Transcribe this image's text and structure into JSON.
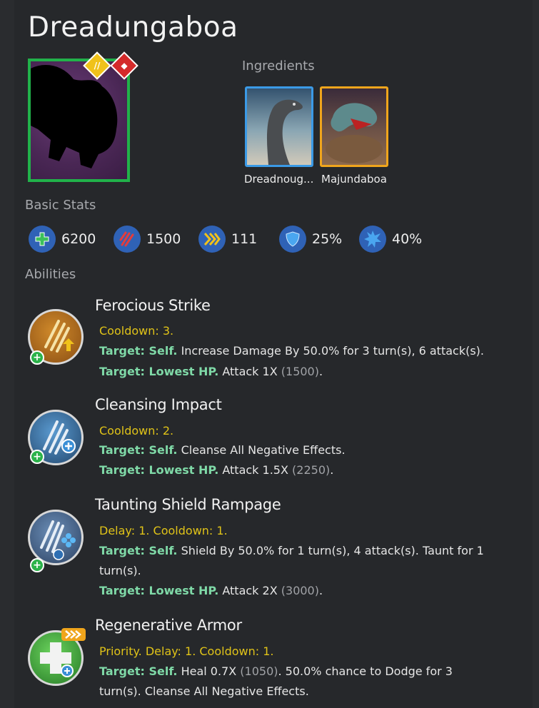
{
  "title": "Dreadungaboa",
  "ingredients": {
    "label": "Ingredients",
    "items": [
      {
        "name": "Dreadnoug..."
      },
      {
        "name": "Majundaboa"
      }
    ]
  },
  "basic_stats": {
    "label": "Basic Stats",
    "items": [
      {
        "icon": "health-icon",
        "value": "6200"
      },
      {
        "icon": "damage-icon",
        "value": "1500"
      },
      {
        "icon": "speed-icon",
        "value": "111"
      },
      {
        "icon": "armor-icon",
        "value": "25%"
      },
      {
        "icon": "crit-icon",
        "value": "40%"
      }
    ]
  },
  "abilities": {
    "label": "Abilities",
    "items": [
      {
        "name": "Ferocious Strike",
        "timing": "Cooldown: 3.",
        "lines": [
          {
            "target": "Target: Self.",
            "text": " Increase Damage By 50.0% for 3 turn(s), 6 attack(s)."
          },
          {
            "target": "Target: Lowest HP.",
            "text": " Attack 1X ",
            "grey": "(1500)",
            "tail": "."
          }
        ]
      },
      {
        "name": "Cleansing Impact",
        "timing": "Cooldown: 2.",
        "lines": [
          {
            "target": "Target: Self.",
            "text": " Cleanse All Negative Effects."
          },
          {
            "target": "Target: Lowest HP.",
            "text": " Attack 1.5X ",
            "grey": "(2250)",
            "tail": "."
          }
        ]
      },
      {
        "name": "Taunting Shield Rampage",
        "timing": "Delay: 1. Cooldown: 1.",
        "lines": [
          {
            "target": "Target: Self.",
            "text": " Shield By 50.0% for 1 turn(s), 4 attack(s). Taunt for 1"
          },
          {
            "target": "",
            "text": "turn(s)."
          },
          {
            "target": "Target: Lowest HP.",
            "text": " Attack 2X ",
            "grey": "(3000)",
            "tail": "."
          }
        ]
      },
      {
        "name": "Regenerative Armor",
        "timing": "Priority. Delay: 1. Cooldown: 1.",
        "lines": [
          {
            "target": "Target: Self.",
            "text": " Heal 0.7X ",
            "grey": "(1050)",
            "tail": ". 50.0% chance to Dodge for 3"
          },
          {
            "target": "",
            "text": "turn(s). Cleanse All Negative Effects."
          }
        ]
      }
    ]
  },
  "colors": {
    "portrait_border": "#21b24a",
    "ingredient_1_border": "#3b9ae6",
    "ingredient_2_border": "#f0a51c",
    "timing_text": "#e0c318",
    "target_text": "#7fd9a7",
    "stat_icon_bg": "#2f62b6"
  }
}
